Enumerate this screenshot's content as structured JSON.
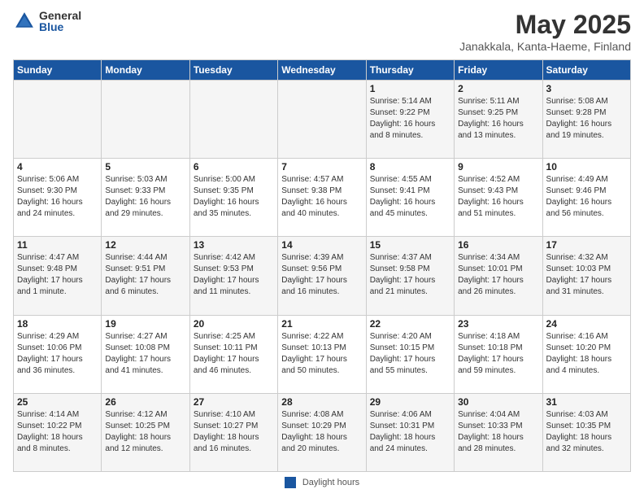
{
  "header": {
    "logo_general": "General",
    "logo_blue": "Blue",
    "title": "May 2025",
    "subtitle": "Janakkala, Kanta-Haeme, Finland"
  },
  "days_of_week": [
    "Sunday",
    "Monday",
    "Tuesday",
    "Wednesday",
    "Thursday",
    "Friday",
    "Saturday"
  ],
  "weeks": [
    [
      {
        "day": "",
        "info": ""
      },
      {
        "day": "",
        "info": ""
      },
      {
        "day": "",
        "info": ""
      },
      {
        "day": "",
        "info": ""
      },
      {
        "day": "1",
        "info": "Sunrise: 5:14 AM\nSunset: 9:22 PM\nDaylight: 16 hours\nand 8 minutes."
      },
      {
        "day": "2",
        "info": "Sunrise: 5:11 AM\nSunset: 9:25 PM\nDaylight: 16 hours\nand 13 minutes."
      },
      {
        "day": "3",
        "info": "Sunrise: 5:08 AM\nSunset: 9:28 PM\nDaylight: 16 hours\nand 19 minutes."
      }
    ],
    [
      {
        "day": "4",
        "info": "Sunrise: 5:06 AM\nSunset: 9:30 PM\nDaylight: 16 hours\nand 24 minutes."
      },
      {
        "day": "5",
        "info": "Sunrise: 5:03 AM\nSunset: 9:33 PM\nDaylight: 16 hours\nand 29 minutes."
      },
      {
        "day": "6",
        "info": "Sunrise: 5:00 AM\nSunset: 9:35 PM\nDaylight: 16 hours\nand 35 minutes."
      },
      {
        "day": "7",
        "info": "Sunrise: 4:57 AM\nSunset: 9:38 PM\nDaylight: 16 hours\nand 40 minutes."
      },
      {
        "day": "8",
        "info": "Sunrise: 4:55 AM\nSunset: 9:41 PM\nDaylight: 16 hours\nand 45 minutes."
      },
      {
        "day": "9",
        "info": "Sunrise: 4:52 AM\nSunset: 9:43 PM\nDaylight: 16 hours\nand 51 minutes."
      },
      {
        "day": "10",
        "info": "Sunrise: 4:49 AM\nSunset: 9:46 PM\nDaylight: 16 hours\nand 56 minutes."
      }
    ],
    [
      {
        "day": "11",
        "info": "Sunrise: 4:47 AM\nSunset: 9:48 PM\nDaylight: 17 hours\nand 1 minute."
      },
      {
        "day": "12",
        "info": "Sunrise: 4:44 AM\nSunset: 9:51 PM\nDaylight: 17 hours\nand 6 minutes."
      },
      {
        "day": "13",
        "info": "Sunrise: 4:42 AM\nSunset: 9:53 PM\nDaylight: 17 hours\nand 11 minutes."
      },
      {
        "day": "14",
        "info": "Sunrise: 4:39 AM\nSunset: 9:56 PM\nDaylight: 17 hours\nand 16 minutes."
      },
      {
        "day": "15",
        "info": "Sunrise: 4:37 AM\nSunset: 9:58 PM\nDaylight: 17 hours\nand 21 minutes."
      },
      {
        "day": "16",
        "info": "Sunrise: 4:34 AM\nSunset: 10:01 PM\nDaylight: 17 hours\nand 26 minutes."
      },
      {
        "day": "17",
        "info": "Sunrise: 4:32 AM\nSunset: 10:03 PM\nDaylight: 17 hours\nand 31 minutes."
      }
    ],
    [
      {
        "day": "18",
        "info": "Sunrise: 4:29 AM\nSunset: 10:06 PM\nDaylight: 17 hours\nand 36 minutes."
      },
      {
        "day": "19",
        "info": "Sunrise: 4:27 AM\nSunset: 10:08 PM\nDaylight: 17 hours\nand 41 minutes."
      },
      {
        "day": "20",
        "info": "Sunrise: 4:25 AM\nSunset: 10:11 PM\nDaylight: 17 hours\nand 46 minutes."
      },
      {
        "day": "21",
        "info": "Sunrise: 4:22 AM\nSunset: 10:13 PM\nDaylight: 17 hours\nand 50 minutes."
      },
      {
        "day": "22",
        "info": "Sunrise: 4:20 AM\nSunset: 10:15 PM\nDaylight: 17 hours\nand 55 minutes."
      },
      {
        "day": "23",
        "info": "Sunrise: 4:18 AM\nSunset: 10:18 PM\nDaylight: 17 hours\nand 59 minutes."
      },
      {
        "day": "24",
        "info": "Sunrise: 4:16 AM\nSunset: 10:20 PM\nDaylight: 18 hours\nand 4 minutes."
      }
    ],
    [
      {
        "day": "25",
        "info": "Sunrise: 4:14 AM\nSunset: 10:22 PM\nDaylight: 18 hours\nand 8 minutes."
      },
      {
        "day": "26",
        "info": "Sunrise: 4:12 AM\nSunset: 10:25 PM\nDaylight: 18 hours\nand 12 minutes."
      },
      {
        "day": "27",
        "info": "Sunrise: 4:10 AM\nSunset: 10:27 PM\nDaylight: 18 hours\nand 16 minutes."
      },
      {
        "day": "28",
        "info": "Sunrise: 4:08 AM\nSunset: 10:29 PM\nDaylight: 18 hours\nand 20 minutes."
      },
      {
        "day": "29",
        "info": "Sunrise: 4:06 AM\nSunset: 10:31 PM\nDaylight: 18 hours\nand 24 minutes."
      },
      {
        "day": "30",
        "info": "Sunrise: 4:04 AM\nSunset: 10:33 PM\nDaylight: 18 hours\nand 28 minutes."
      },
      {
        "day": "31",
        "info": "Sunrise: 4:03 AM\nSunset: 10:35 PM\nDaylight: 18 hours\nand 32 minutes."
      }
    ]
  ],
  "footer": {
    "legend_label": "Daylight hours"
  }
}
